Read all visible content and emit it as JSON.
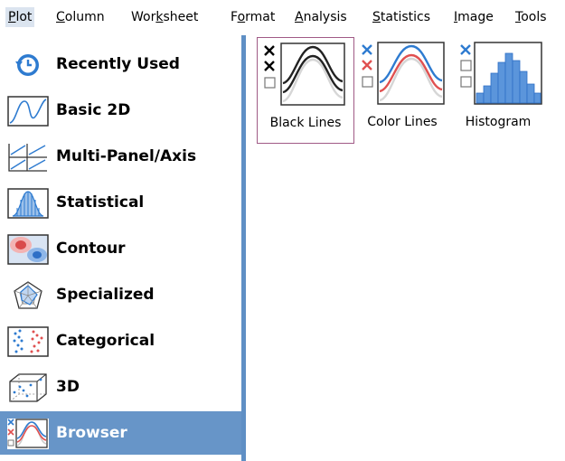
{
  "menubar": {
    "items": [
      {
        "pre": "",
        "mn": "P",
        "post": "lot"
      },
      {
        "pre": "",
        "mn": "C",
        "post": "olumn"
      },
      {
        "pre": "Wor",
        "mn": "k",
        "post": "sheet"
      },
      {
        "pre": "F",
        "mn": "o",
        "post": "rmat"
      },
      {
        "pre": "",
        "mn": "A",
        "post": "nalysis"
      },
      {
        "pre": "",
        "mn": "S",
        "post": "tatistics"
      },
      {
        "pre": "",
        "mn": "I",
        "post": "mage"
      },
      {
        "pre": "",
        "mn": "T",
        "post": "ools"
      }
    ]
  },
  "categories": [
    {
      "label": "Recently Used",
      "icon": "recently-used-icon"
    },
    {
      "label": "Basic 2D",
      "icon": "basic-2d-icon"
    },
    {
      "label": "Multi-Panel/Axis",
      "icon": "multi-panel-axis-icon"
    },
    {
      "label": "Statistical",
      "icon": "statistical-icon"
    },
    {
      "label": "Contour",
      "icon": "contour-icon"
    },
    {
      "label": "Specialized",
      "icon": "specialized-icon"
    },
    {
      "label": "Categorical",
      "icon": "categorical-icon"
    },
    {
      "label": "3D",
      "icon": "3d-icon"
    },
    {
      "label": "Browser",
      "icon": "browser-icon",
      "selected": true
    }
  ],
  "templates": [
    {
      "label": "Black Lines",
      "icon": "black-lines-icon",
      "selected": true
    },
    {
      "label": "Color Lines",
      "icon": "color-lines-icon"
    },
    {
      "label": "Histogram",
      "icon": "histogram-icon"
    }
  ],
  "colors": {
    "accent": "#6795c8",
    "divider": "#5f8fc5",
    "selection_border": "#a05a86",
    "red_line": "#e05050",
    "blue_line": "#3f7fd6"
  }
}
